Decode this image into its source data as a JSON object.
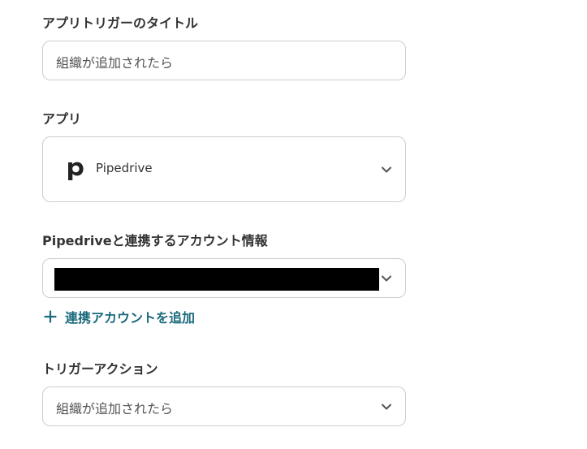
{
  "trigger_title": {
    "label": "アプリトリガーのタイトル",
    "value": "組織が追加されたら"
  },
  "app": {
    "label": "アプリ",
    "selected": "Pipedrive",
    "logo_icon": "pipedrive-p-icon"
  },
  "account": {
    "label": "Pipedriveと連携するアカウント情報",
    "add_link": "連携アカウントを追加"
  },
  "trigger_action": {
    "label": "トリガーアクション",
    "selected": "組織が追加されたら"
  },
  "colors": {
    "link": "#1c6a7d",
    "border": "#c9cdd2",
    "text": "#333333",
    "redaction": "#000000"
  }
}
